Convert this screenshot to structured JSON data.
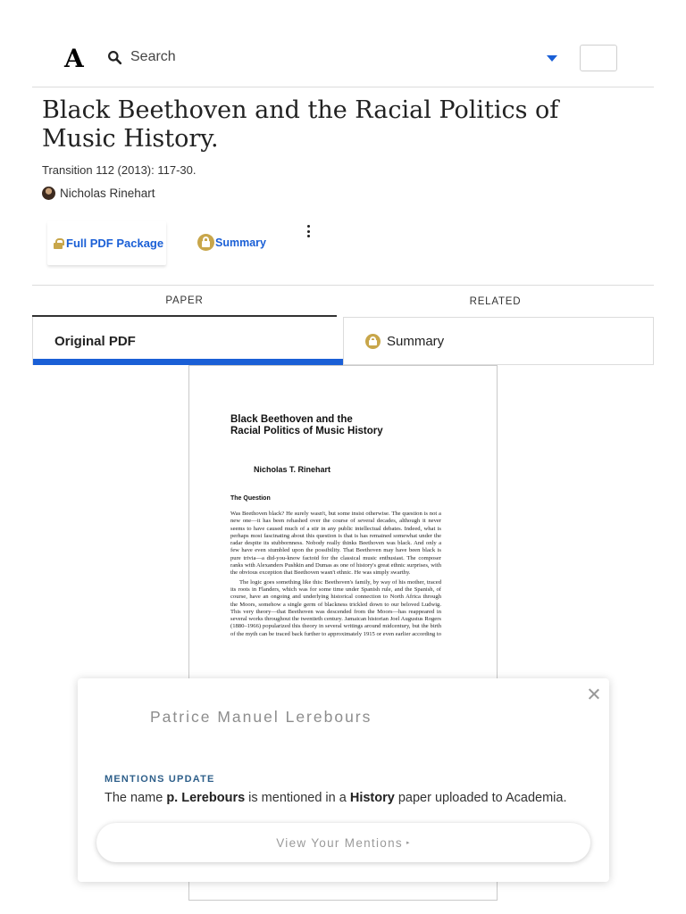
{
  "header": {
    "logo": "A",
    "search_label": "Search"
  },
  "paper": {
    "title": "Black Beethoven and the Racial Politics of Music History.",
    "citation": "Transition 112 (2013): 117-30.",
    "author": "Nicholas Rinehart"
  },
  "actions": {
    "pdf_package": "Full PDF Package",
    "summary": "Summary"
  },
  "tabs": [
    {
      "label": "PAPER"
    },
    {
      "label": "RELATED"
    }
  ],
  "subtabs": {
    "original": "Original PDF",
    "summary": "Summary"
  },
  "pdf": {
    "title_line1": "Black Beethoven and the",
    "title_line2": "Racial Politics of Music History",
    "author": "Nicholas T. Rinehart",
    "section": "The Question",
    "para1": "Was Beethoven black? He surely wasn't, but some insist otherwise. The question is not a new one—it has been rehashed over the course of several decades, although it never seems to have caused much of a stir in any public intellectual debates. Indeed, what is perhaps most fascinating about this question is that is has remained somewhat under the radar despite its stubbornness. Nobody really thinks Beethoven was black. And only a few have even stumbled upon the possibility. That Beethoven may have been black is pure trivia—a did-you-know factoid for the classical music enthusiast. The composer ranks with Alexanders Pushkin and Dumas as one of history's great ethnic surprises, with the obvious exception that Beethoven wasn't ethnic. He was simply swarthy.",
    "para2": "The logic goes something like this: Beethoven's family, by way of his mother, traced its roots in Flanders, which was for some time under Spanish rule, and the Spanish, of course, have an ongoing and underlying historical connection to North Africa through the Moors, somehow a single germ of blackness trickled down to our beloved Ludwig. This very theory—that Beethoven was descended from the Moors—has reappeared in several works throughout the twentieth century. Jamaican historian Joel Augustus Rogers (1880–1966) popularized this theory in several writings around midcentury, but the birth of the myth can be traced back further to approximately 1915 or even earlier according to"
  },
  "popup": {
    "name": "Patrice Manuel Lerebours",
    "heading": "MENTIONS UPDATE",
    "msg_pre": "The name ",
    "msg_name": "p. Lerebours",
    "msg_mid": " is mentioned in a ",
    "msg_topic": "History",
    "msg_post": " paper uploaded to Academia.",
    "button": "View Your Mentions",
    "button_arrow": "▸"
  },
  "colors": {
    "accent": "#1a5fd6",
    "lock": "#c8a64a",
    "mentions_heading": "#2e5f8a"
  }
}
